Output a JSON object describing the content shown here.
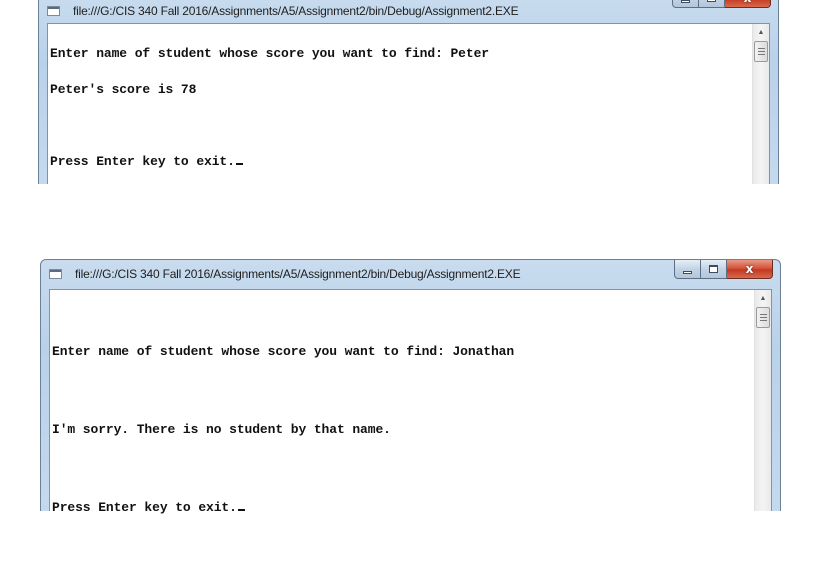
{
  "windows": [
    {
      "title": "file:///G:/CIS 340 Fall 2016/Assignments/A5/Assignment2/bin/Debug/Assignment2.EXE",
      "console_lines": [
        "Enter name of student whose score you want to find: Peter",
        "Peter's score is 78",
        "",
        "Press Enter key to exit."
      ],
      "icons": {
        "app": "console-app-icon",
        "minimize": "minimize-icon",
        "maximize": "maximize-icon",
        "close": "close-icon"
      },
      "close_glyph": "x",
      "scroll_up_glyph": "▲"
    },
    {
      "title": "file:///G:/CIS 340 Fall 2016/Assignments/A5/Assignment2/bin/Debug/Assignment2.EXE",
      "console_lines": [
        "Enter name of student whose score you want to find: Jonathan",
        "I'm sorry. There is no student by that name.",
        "Press Enter key to exit."
      ],
      "icons": {
        "app": "console-app-icon",
        "minimize": "minimize-icon",
        "maximize": "maximize-icon",
        "close": "close-icon"
      },
      "close_glyph": "x",
      "scroll_up_glyph": "▲"
    }
  ],
  "colors": {
    "frame": "#b9d1ea",
    "close_button": "#c3391f",
    "console_text": "#111111",
    "console_bg": "#ffffff"
  }
}
